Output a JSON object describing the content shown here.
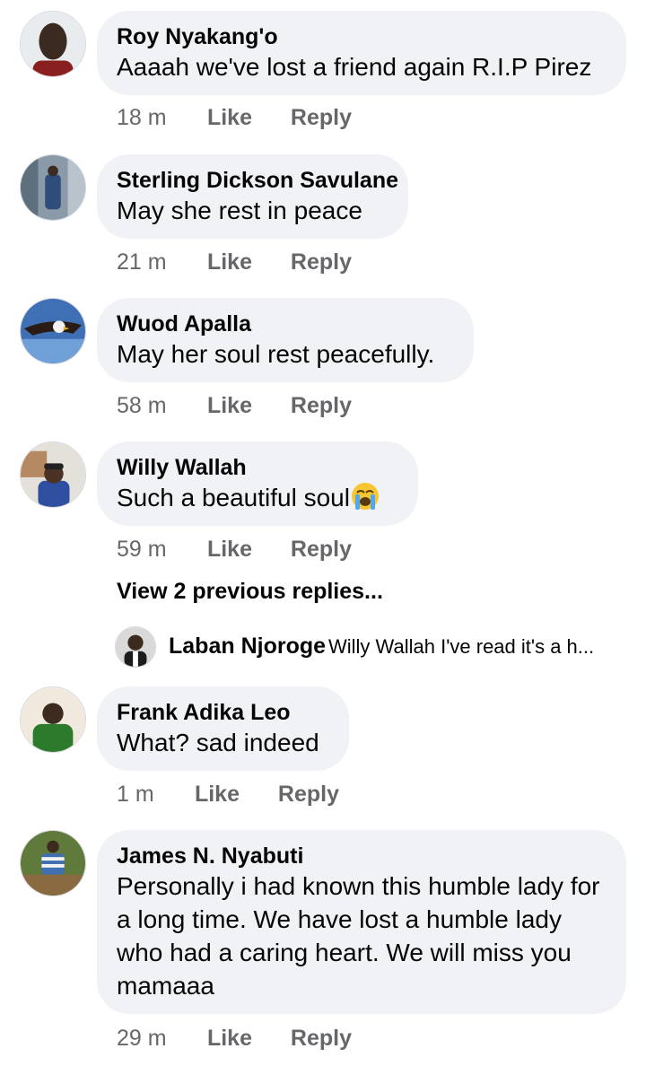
{
  "comments": [
    {
      "author": "Roy Nyakang'o",
      "text": "Aaaah we've lost a friend again R.I.P Pirez",
      "time": "18 m",
      "like": "Like",
      "reply": "Reply"
    },
    {
      "author": "Sterling Dickson Savulane",
      "text": "May she rest in peace",
      "time": "21 m",
      "like": "Like",
      "reply": "Reply"
    },
    {
      "author": "Wuod Apalla",
      "text": "May her soul rest peacefully.",
      "time": "58 m",
      "like": "Like",
      "reply": "Reply"
    },
    {
      "author": "Willy Wallah",
      "text": "Such a beautiful soul",
      "emoji": "loudly-crying-face-emoji",
      "time": "59 m",
      "like": "Like",
      "reply": "Reply"
    },
    {
      "author": "Frank Adika Leo",
      "text": "What? sad indeed",
      "time": "1 m",
      "like": "Like",
      "reply": "Reply"
    },
    {
      "author": "James N. Nyabuti",
      "text": "Personally i had known this humble lady for a long time. We have lost a humble lady who had a caring heart. We will miss you mamaaa",
      "time": "29 m",
      "like": "Like",
      "reply": "Reply"
    }
  ],
  "thread": {
    "view_previous": "View 2 previous replies...",
    "reply": {
      "author": "Laban Njoroge",
      "text": "Willy Wallah I've read it's a h..."
    }
  },
  "colors": {
    "bubble": "#f0f2f5",
    "meta": "#65676b",
    "text": "#050505"
  }
}
